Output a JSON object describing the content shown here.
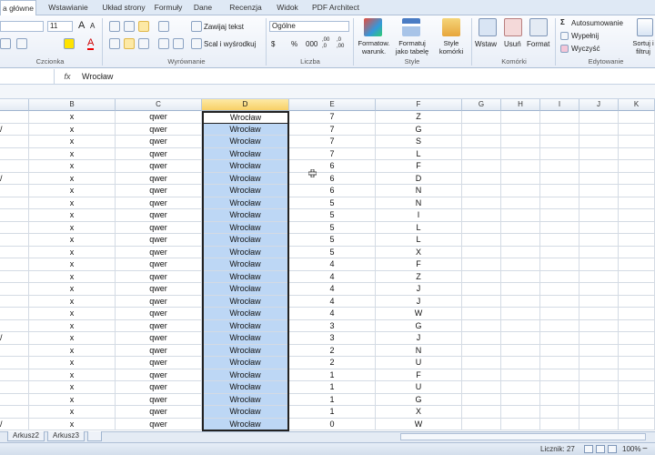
{
  "tabs": [
    "a główne",
    "Wstawianie",
    "Układ strony",
    "Formuły",
    "Dane",
    "Recenzja",
    "Widok",
    "PDF Architect"
  ],
  "ribbon": {
    "font_size": "11",
    "font_grow": "A",
    "font_shrink": "A",
    "font_color_glyph": "A",
    "wrap_text": "Zawijaj tekst",
    "merge_center": "Scal i wyśrodkuj",
    "number_format": "Ogólne",
    "currency": "$",
    "percent": "%",
    "thousands": "000",
    "dec_inc": ",00 ,0",
    "dec_dec": ",0 ,00",
    "cond_format": "Formatow. warunk.",
    "format_table": "Formatuj jako tabelę",
    "cell_styles": "Style komórki",
    "insert": "Wstaw",
    "delete": "Usuń",
    "format": "Format",
    "autosum": "Autosumowanie",
    "fill": "Wypełnij",
    "clear": "Wyczyść",
    "sort": "Sortuj i filtruj",
    "groups": [
      "Czcionka",
      "Wyrównanie",
      "Liczba",
      "Style",
      "Komórki",
      "Edytowanie"
    ]
  },
  "formula_bar": {
    "fx": "fx",
    "value": "Wrocław"
  },
  "columns": [
    "B",
    "C",
    "D",
    "E",
    "F",
    "G",
    "H",
    "I",
    "J",
    "K"
  ],
  "rows": [
    {
      "b": "x",
      "c": "qwer",
      "d": "Wrocław",
      "e": "7",
      "f": "Z"
    },
    {
      "b": "x",
      "c": "qwer",
      "d": "Wrocław",
      "e": "7",
      "f": "G"
    },
    {
      "b": "x",
      "c": "qwer",
      "d": "Wrocław",
      "e": "7",
      "f": "S"
    },
    {
      "b": "x",
      "c": "qwer",
      "d": "Wrocław",
      "e": "7",
      "f": "L"
    },
    {
      "b": "x",
      "c": "qwer",
      "d": "Wrocław",
      "e": "6",
      "f": "F"
    },
    {
      "b": "x",
      "c": "qwer",
      "d": "Wrocław",
      "e": "6",
      "f": "D"
    },
    {
      "b": "x",
      "c": "qwer",
      "d": "Wrocław",
      "e": "6",
      "f": "N"
    },
    {
      "b": "x",
      "c": "qwer",
      "d": "Wrocław",
      "e": "5",
      "f": "N"
    },
    {
      "b": "x",
      "c": "qwer",
      "d": "Wrocław",
      "e": "5",
      "f": "I"
    },
    {
      "b": "x",
      "c": "qwer",
      "d": "Wrocław",
      "e": "5",
      "f": "L"
    },
    {
      "b": "x",
      "c": "qwer",
      "d": "Wrocław",
      "e": "5",
      "f": "L"
    },
    {
      "b": "x",
      "c": "qwer",
      "d": "Wrocław",
      "e": "5",
      "f": "X"
    },
    {
      "b": "x",
      "c": "qwer",
      "d": "Wrocław",
      "e": "4",
      "f": "F"
    },
    {
      "b": "x",
      "c": "qwer",
      "d": "Wrocław",
      "e": "4",
      "f": "Z"
    },
    {
      "b": "x",
      "c": "qwer",
      "d": "Wrocław",
      "e": "4",
      "f": "J"
    },
    {
      "b": "x",
      "c": "qwer",
      "d": "Wrocław",
      "e": "4",
      "f": "J"
    },
    {
      "b": "x",
      "c": "qwer",
      "d": "Wrocław",
      "e": "4",
      "f": "W"
    },
    {
      "b": "x",
      "c": "qwer",
      "d": "Wrocław",
      "e": "3",
      "f": "G"
    },
    {
      "b": "x",
      "c": "qwer",
      "d": "Wrocław",
      "e": "3",
      "f": "J"
    },
    {
      "b": "x",
      "c": "qwer",
      "d": "Wrocław",
      "e": "2",
      "f": "N"
    },
    {
      "b": "x",
      "c": "qwer",
      "d": "Wrocław",
      "e": "2",
      "f": "U"
    },
    {
      "b": "x",
      "c": "qwer",
      "d": "Wrocław",
      "e": "1",
      "f": "F"
    },
    {
      "b": "x",
      "c": "qwer",
      "d": "Wrocław",
      "e": "1",
      "f": "U"
    },
    {
      "b": "x",
      "c": "qwer",
      "d": "Wrocław",
      "e": "1",
      "f": "G"
    },
    {
      "b": "x",
      "c": "qwer",
      "d": "Wrocław",
      "e": "1",
      "f": "X"
    },
    {
      "b": "x",
      "c": "qwer",
      "d": "Wrocław",
      "e": "0",
      "f": "W"
    }
  ],
  "left_edge_marks": [
    1,
    5,
    18,
    25
  ],
  "left_edge_glyph": "/",
  "sheets": [
    "Arkusz2",
    "Arkusz3"
  ],
  "status": {
    "count": "Licznik: 27",
    "zoom": "100%"
  },
  "colors": {
    "selection": "#bdd7f5",
    "header_selected": "#f8d066",
    "ribbon_bg": "#e8eef7"
  }
}
